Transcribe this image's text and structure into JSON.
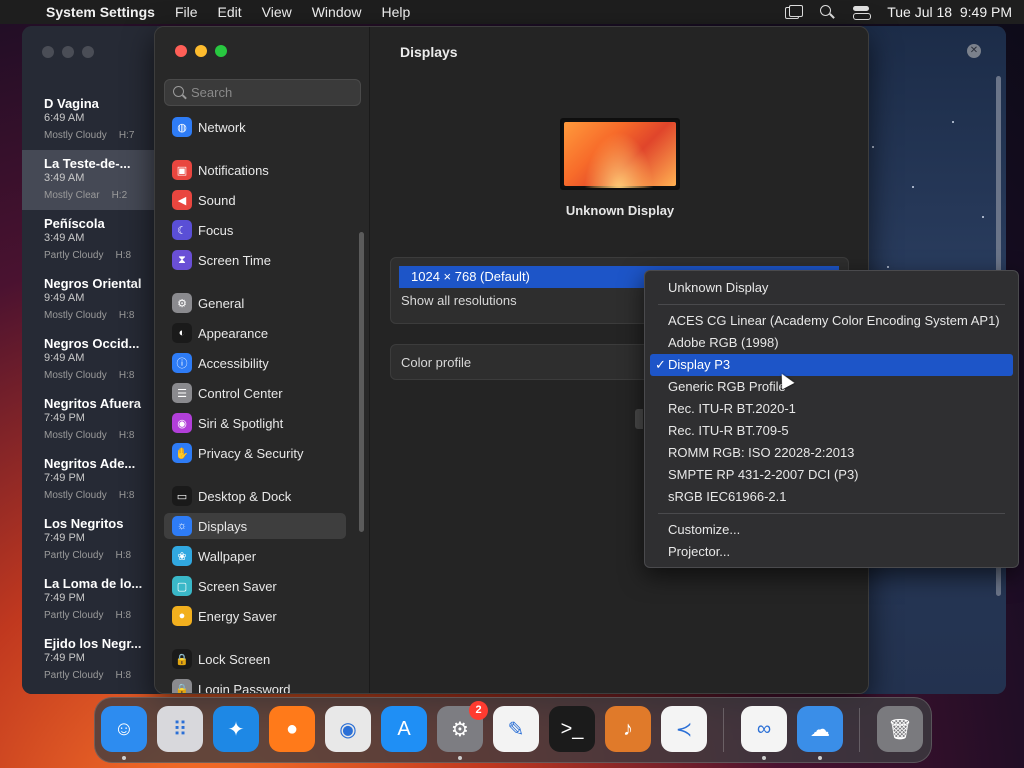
{
  "menubar": {
    "app_name": "System Settings",
    "menus": [
      "File",
      "Edit",
      "View",
      "Window",
      "Help"
    ],
    "clock": "Tue Jul 18  9:49 PM"
  },
  "weather": {
    "cities": [
      {
        "name": "D Vagina",
        "time": "6:49 AM",
        "condition": "Mostly Cloudy",
        "extra": "H:7"
      },
      {
        "name": "La Teste-de-...",
        "time": "3:49 AM",
        "condition": "Mostly Clear",
        "extra": "H:2"
      },
      {
        "name": "Peñíscola",
        "time": "3:49 AM",
        "condition": "Partly Cloudy",
        "extra": "H:8"
      },
      {
        "name": "Negros Oriental",
        "time": "9:49 AM",
        "condition": "Mostly Cloudy",
        "extra": "H:8"
      },
      {
        "name": "Negros Occid...",
        "time": "9:49 AM",
        "condition": "Mostly Cloudy",
        "extra": "H:8"
      },
      {
        "name": "Negritos Afuera",
        "time": "7:49 PM",
        "condition": "Mostly Cloudy",
        "extra": "H:8"
      },
      {
        "name": "Negritos Ade...",
        "time": "7:49 PM",
        "condition": "Mostly Cloudy",
        "extra": "H:8"
      },
      {
        "name": "Los Negritos",
        "time": "7:49 PM",
        "condition": "Partly Cloudy",
        "extra": "H:8"
      },
      {
        "name": "La Loma de lo...",
        "time": "7:49 PM",
        "condition": "Partly Cloudy",
        "extra": "H:8"
      },
      {
        "name": "Ejido los Negr...",
        "time": "7:49 PM",
        "condition": "Partly Cloudy",
        "extra": "H:8"
      }
    ]
  },
  "sidebar": {
    "search_placeholder": "Search",
    "items": [
      {
        "label": "Network",
        "icon": "globe-icon",
        "color": "#2e7cf6",
        "glyph": "◍"
      },
      {
        "label": "Notifications",
        "icon": "bell-icon",
        "color": "#e9463f",
        "glyph": "▣"
      },
      {
        "label": "Sound",
        "icon": "speaker-icon",
        "color": "#e9463f",
        "glyph": "◀"
      },
      {
        "label": "Focus",
        "icon": "moon-icon",
        "color": "#5a4fd6",
        "glyph": "☾"
      },
      {
        "label": "Screen Time",
        "icon": "hourglass-icon",
        "color": "#6a4fd6",
        "glyph": "⧗"
      },
      {
        "label": "General",
        "icon": "gear-icon",
        "color": "#8a8a8e",
        "glyph": "⚙"
      },
      {
        "label": "Appearance",
        "icon": "appearance-icon",
        "color": "#1a1a1a",
        "glyph": "◐"
      },
      {
        "label": "Accessibility",
        "icon": "accessibility-icon",
        "color": "#2e7cf6",
        "glyph": "ⓘ"
      },
      {
        "label": "Control Center",
        "icon": "toggles-icon",
        "color": "#8a8a8e",
        "glyph": "☰"
      },
      {
        "label": "Siri & Spotlight",
        "icon": "siri-icon",
        "color": "#b23fd9",
        "glyph": "◉"
      },
      {
        "label": "Privacy & Security",
        "icon": "hand-icon",
        "color": "#2e7cf6",
        "glyph": "✋"
      },
      {
        "label": "Desktop & Dock",
        "icon": "dock-icon",
        "color": "#1a1a1a",
        "glyph": "▭"
      },
      {
        "label": "Displays",
        "icon": "sun-icon",
        "color": "#2e7cf6",
        "glyph": "☼"
      },
      {
        "label": "Wallpaper",
        "icon": "wallpaper-icon",
        "color": "#31a8e0",
        "glyph": "❀"
      },
      {
        "label": "Screen Saver",
        "icon": "screensaver-icon",
        "color": "#3ab8c8",
        "glyph": "▢"
      },
      {
        "label": "Energy Saver",
        "icon": "bulb-icon",
        "color": "#f2b01e",
        "glyph": "●"
      },
      {
        "label": "Lock Screen",
        "icon": "lock-icon",
        "color": "#1a1a1a",
        "glyph": "🔒"
      },
      {
        "label": "Login Password",
        "icon": "key-icon",
        "color": "#8a8a8e",
        "glyph": "🔒"
      }
    ]
  },
  "content": {
    "title": "Displays",
    "display_name": "Unknown Display",
    "resolution_selected": "1024 × 768 (Default)",
    "show_all_resolutions": "Show all resolutions",
    "color_profile_label": "Color profile"
  },
  "dropdown": {
    "header": "Unknown Display",
    "profiles": [
      "ACES CG Linear (Academy Color Encoding System AP1)",
      "Adobe RGB (1998)",
      "Display P3",
      "Generic RGB Profile",
      "Rec. ITU-R BT.2020-1",
      "Rec. ITU-R BT.709-5",
      "ROMM RGB: ISO 22028-2:2013",
      "SMPTE RP 431-2-2007 DCI (P3)",
      "sRGB IEC61966-2.1"
    ],
    "selected": "Display P3",
    "check_mark": "✓",
    "actions": [
      "Customize...",
      "Projector..."
    ]
  },
  "dock": {
    "apps": [
      {
        "name": "Finder",
        "icon": "finder-icon",
        "glyph": "☺",
        "color": "#2d8cf0"
      },
      {
        "name": "Launchpad",
        "icon": "launchpad-icon",
        "glyph": "⠿",
        "color": "#d8d8dc"
      },
      {
        "name": "Safari",
        "icon": "safari-icon",
        "glyph": "✦",
        "color": "#1e88e5"
      },
      {
        "name": "Firefox",
        "icon": "firefox-icon",
        "glyph": "●",
        "color": "#ff7a1a"
      },
      {
        "name": "Chrome",
        "icon": "chrome-icon",
        "glyph": "◉",
        "color": "#e8e8e8"
      },
      {
        "name": "App Store",
        "icon": "appstore-icon",
        "glyph": "A",
        "color": "#1f8ff5"
      },
      {
        "name": "System Settings",
        "icon": "settings-gear-icon",
        "glyph": "⚙",
        "color": "#7d7d82",
        "badge": "2"
      },
      {
        "name": "TextEdit",
        "icon": "textedit-icon",
        "glyph": "✎",
        "color": "#f3f3f3"
      },
      {
        "name": "Terminal",
        "icon": "terminal-icon",
        "glyph": ">_",
        "color": "#1b1b1b"
      },
      {
        "name": "GarageBand",
        "icon": "guitar-icon",
        "glyph": "♪",
        "color": "#e07a2a"
      },
      {
        "name": "Visual Studio Code",
        "icon": "vscode-icon",
        "glyph": "≺",
        "color": "#f4f4f4"
      },
      {
        "name": "Visual Studio",
        "icon": "visualstudio-icon",
        "glyph": "∞",
        "color": "#f4f4f4"
      },
      {
        "name": "Weather",
        "icon": "weather-icon",
        "glyph": "☁",
        "color": "#3a8ee8"
      },
      {
        "name": "Trash",
        "icon": "trash-icon",
        "glyph": "🗑",
        "color": "#7a7a7e"
      }
    ]
  }
}
